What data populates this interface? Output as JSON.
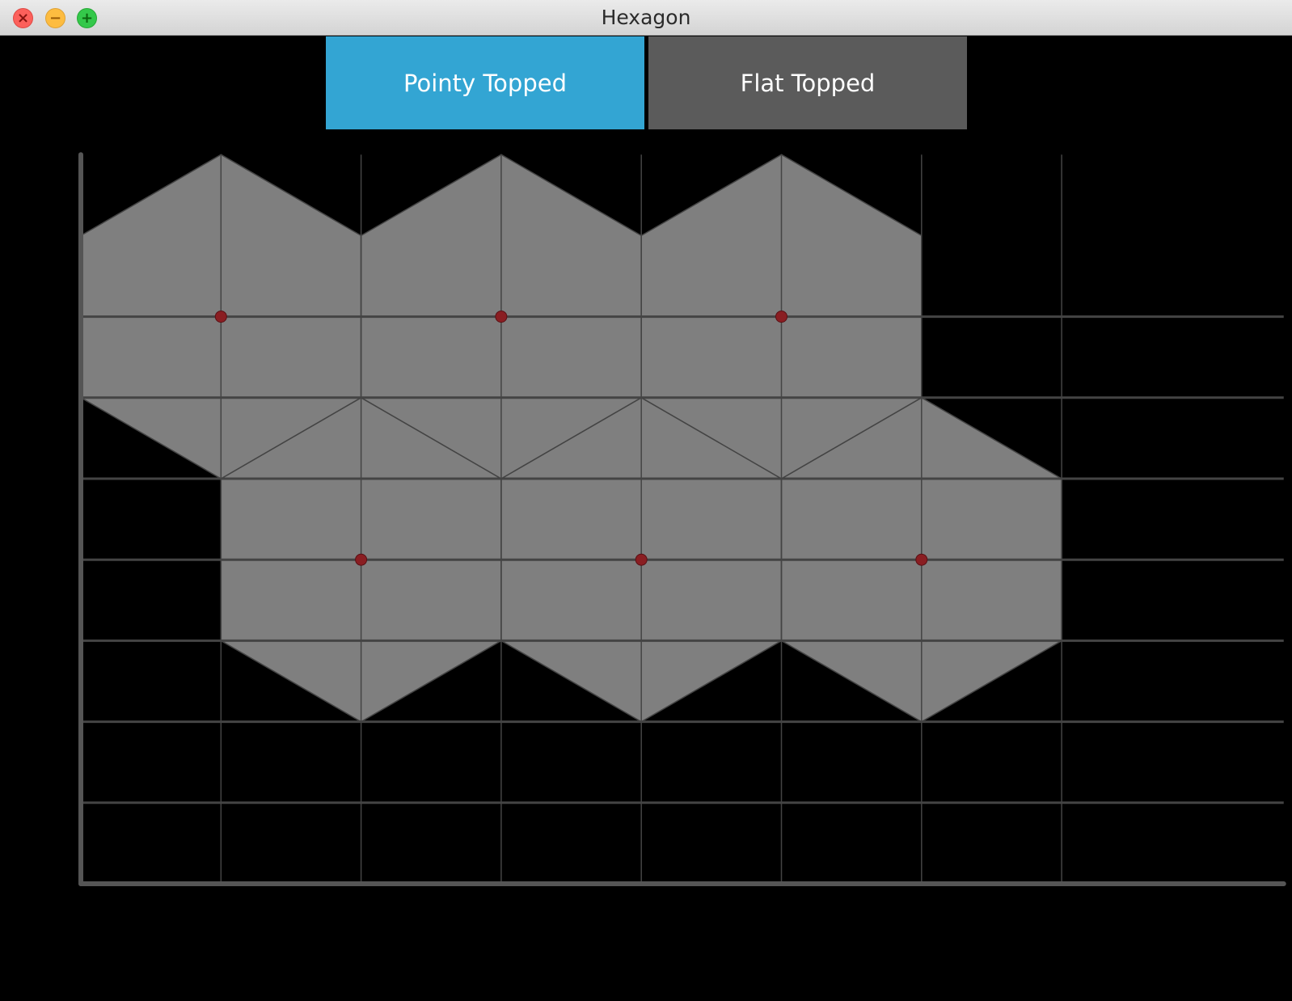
{
  "window": {
    "title": "Hexagon"
  },
  "toolbar": {
    "options": [
      "Pointy Topped",
      "Flat Topped"
    ],
    "selected": "Pointy Topped"
  },
  "colors": {
    "selected_button": "#33a5d3",
    "unselected_button": "#5b5b5b",
    "hex_fill": "#7f7f7f",
    "grid_line": "#444444",
    "axis_line": "#555555",
    "center_marker": "#8a1e22",
    "background": "#000000"
  },
  "grid": {
    "columns": 8,
    "rows": 9
  },
  "hexagons": {
    "orientation": "pointy",
    "centers": [
      {
        "col": 2,
        "row": 4
      },
      {
        "col": 4,
        "row": 4
      },
      {
        "col": 6,
        "row": 4
      },
      {
        "col": 1,
        "row": 7
      },
      {
        "col": 3,
        "row": 7
      },
      {
        "col": 5,
        "row": 7
      }
    ]
  }
}
